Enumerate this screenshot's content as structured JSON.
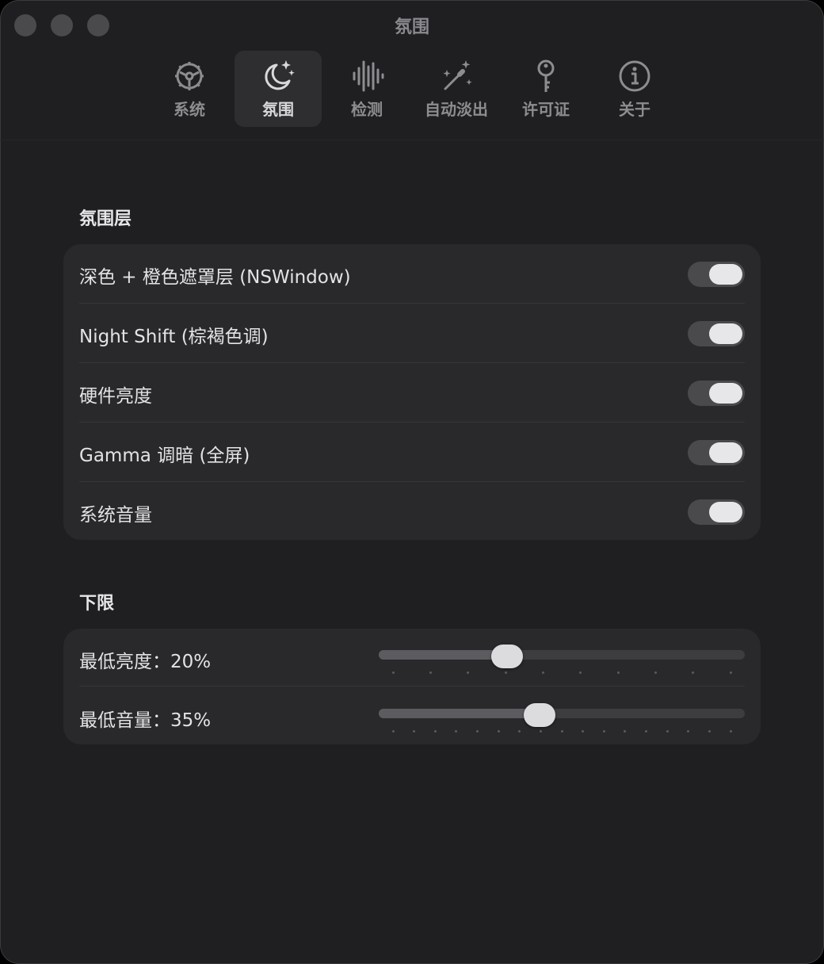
{
  "window": {
    "title": "氛围"
  },
  "tabs": [
    {
      "label": "系统",
      "icon": "gear-steering-icon",
      "active": false
    },
    {
      "label": "氛围",
      "icon": "moon-stars-icon",
      "active": true
    },
    {
      "label": "检测",
      "icon": "waveform-icon",
      "active": false
    },
    {
      "label": "自动淡出",
      "icon": "magic-wand-icon",
      "active": false
    },
    {
      "label": "许可证",
      "icon": "key-icon",
      "active": false
    },
    {
      "label": "关于",
      "icon": "info-icon",
      "active": false
    }
  ],
  "layers": {
    "title": "氛围层",
    "items": [
      {
        "label": "深色 + 橙色遮罩层 (NSWindow)",
        "enabled": true
      },
      {
        "label": "Night Shift (棕褐色调)",
        "enabled": true
      },
      {
        "label": "硬件亮度",
        "enabled": true
      },
      {
        "label": "Gamma 调暗 (全屏)",
        "enabled": true
      },
      {
        "label": "系统音量",
        "enabled": true
      }
    ]
  },
  "limits": {
    "title": "下限",
    "items": [
      {
        "label": "最低亮度：20%",
        "value": 0.35,
        "ticks": 10
      },
      {
        "label": "最低音量：35%",
        "value": 0.44,
        "ticks": 17
      }
    ]
  },
  "colors": {
    "window_bg": "#1f1f21",
    "group_bg": "#29292b",
    "toggle_on": "#4a4a4d"
  }
}
